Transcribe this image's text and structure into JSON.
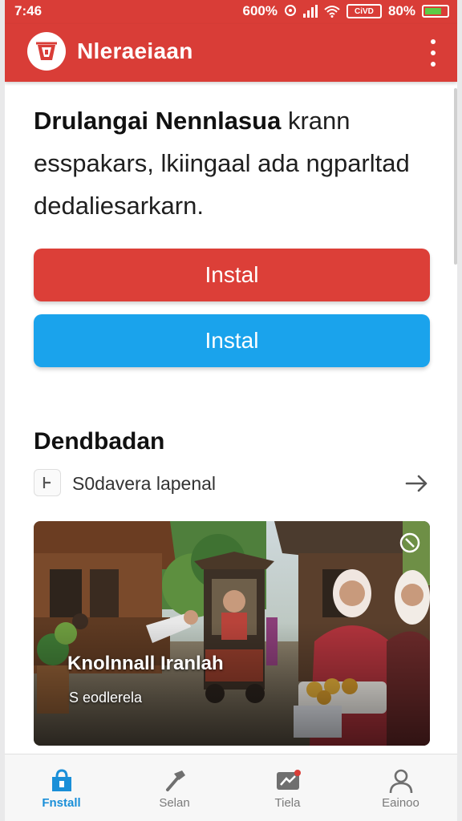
{
  "status_bar": {
    "time": "7:46",
    "left_percent": "600%",
    "right_percent": "80%",
    "battery_label": "CiVD"
  },
  "app_bar": {
    "title": "Nleraeiaan",
    "logo_icon": "app-logo-icon",
    "menu_icon": "more-vert-icon"
  },
  "intro": {
    "headline_bold": "Drulangai Nennlasua",
    "headline_rest": " krann esspakars, lkiingaal ada ngparltad dedaliesarkarn."
  },
  "buttons": {
    "install_red": "Instal",
    "install_blue": "Instal"
  },
  "section": {
    "title": "Dendbadan",
    "row_label": "S0davera lapenal",
    "row_icon": "bookmark-icon",
    "arrow_icon": "arrow-right-icon"
  },
  "photo": {
    "title": "Knolnnall Iranlah",
    "subtitle": "S    eodlerela",
    "badge_icon": "close-circle-icon"
  },
  "bottom_nav": {
    "items": [
      {
        "label": "Fnstall",
        "icon": "store-icon",
        "active": true
      },
      {
        "label": "Selan",
        "icon": "hammer-icon",
        "active": false
      },
      {
        "label": "Tiela",
        "icon": "message-icon",
        "active": false
      },
      {
        "label": "Eainoo",
        "icon": "person-icon",
        "active": false
      }
    ]
  },
  "colors": {
    "brand_red": "#d93d37",
    "accent_blue": "#1aa3ec",
    "active_nav": "#1a8fd8"
  }
}
